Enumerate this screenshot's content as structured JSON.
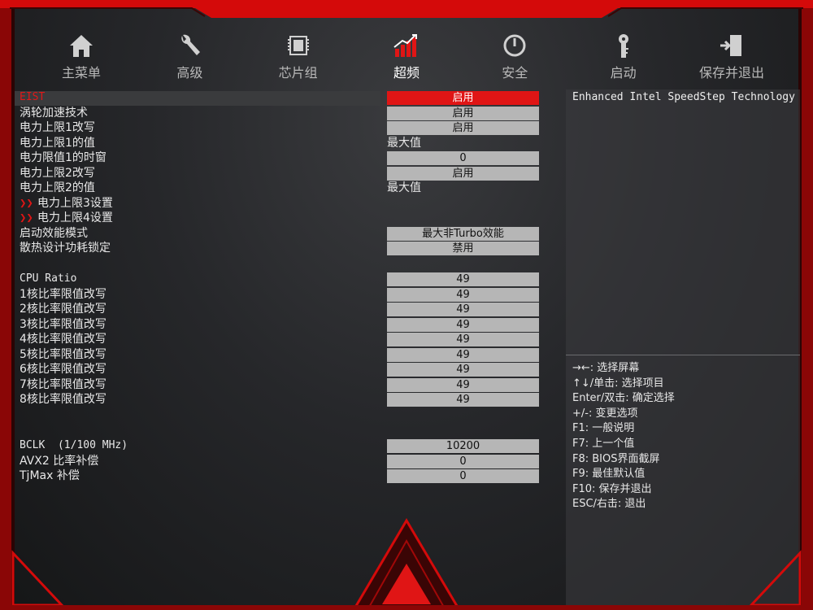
{
  "nav": {
    "items": [
      {
        "label": "主菜单",
        "icon": "home-icon"
      },
      {
        "label": "高级",
        "icon": "wrench-icon"
      },
      {
        "label": "芯片组",
        "icon": "chip-icon"
      },
      {
        "label": "超频",
        "icon": "overclock-chart-icon"
      },
      {
        "label": "安全",
        "icon": "power-lock-icon"
      },
      {
        "label": "启动",
        "icon": "key-icon"
      },
      {
        "label": "保存并退出",
        "icon": "exit-door-icon"
      }
    ],
    "active_index": 3
  },
  "settings": {
    "rows": [
      {
        "label": "EIST",
        "value": "启用"
      },
      {
        "label": "涡轮加速技术",
        "value": "启用"
      },
      {
        "label": "电力上限1改写",
        "value": "启用"
      },
      {
        "label": "电力上限1的值",
        "value": "最大值"
      },
      {
        "label": "电力限值1的时窗",
        "value": "0"
      },
      {
        "label": "电力上限2改写",
        "value": "启用"
      },
      {
        "label": "电力上限2的值",
        "value": "最大值"
      },
      {
        "label": "电力上限3设置"
      },
      {
        "label": "电力上限4设置"
      },
      {
        "label": "启动效能模式",
        "value": "最大非Turbo效能"
      },
      {
        "label": "散热设计功耗锁定",
        "value": "禁用"
      },
      {
        "label": "CPU Ratio",
        "value": "49"
      },
      {
        "label": "1核比率限值改写",
        "value": "49"
      },
      {
        "label": "2核比率限值改写",
        "value": "49"
      },
      {
        "label": "3核比率限值改写",
        "value": "49"
      },
      {
        "label": "4核比率限值改写",
        "value": "49"
      },
      {
        "label": "5核比率限值改写",
        "value": "49"
      },
      {
        "label": "6核比率限值改写",
        "value": "49"
      },
      {
        "label": "7核比率限值改写",
        "value": "49"
      },
      {
        "label": "8核比率限值改写",
        "value": "49"
      },
      {
        "label": "BCLK  (1/100 MHz)",
        "value": "10200"
      },
      {
        "label": "AVX2 比率补偿",
        "value": "0"
      },
      {
        "label": "TjMax 补偿",
        "value": "0"
      }
    ]
  },
  "help": {
    "description": "Enhanced Intel SpeedStep Technology",
    "keys": [
      "→←: 选择屏幕",
      "↑↓/单击: 选择项目",
      "Enter/双击: 确定选择",
      "+/-: 变更选项",
      "F1: 一般说明",
      "F7: 上一个值",
      "F8: BIOS界面截屏",
      "F9: 最佳默认值",
      "F10: 保存并退出",
      "ESC/右击: 退出"
    ]
  },
  "colors": {
    "accent": "#e01515",
    "value_box": "#b6b6b6",
    "background": "#232426"
  }
}
